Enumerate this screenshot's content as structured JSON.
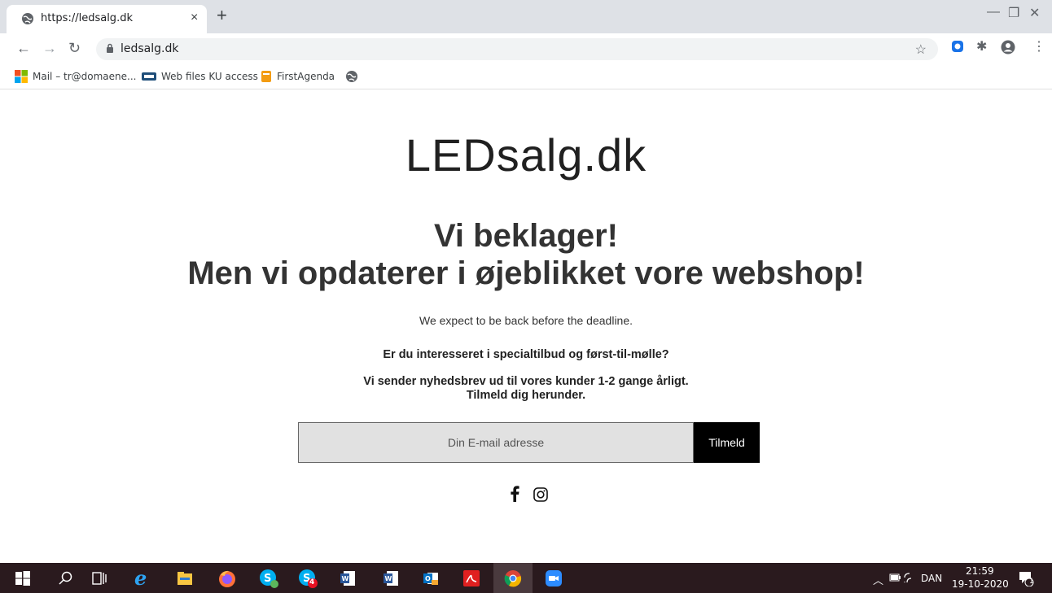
{
  "browser": {
    "tab_title": "https://ledsalg.dk",
    "tab_close": "×",
    "new_tab": "+",
    "url": "ledsalg.dk",
    "bookmarks": [
      {
        "label": "Mail – tr@domaene..."
      },
      {
        "label": "Web files KU access"
      },
      {
        "label": "FirstAgenda"
      }
    ]
  },
  "page": {
    "logo": "LEDsalg.dk",
    "headline_1": "Vi beklager!",
    "headline_2": "Men vi opdaterer i øjeblikket vore webshop!",
    "expect_text": "We expect to be back before the deadline.",
    "interest_text": "Er du interesseret i specialtilbud og først-til-mølle?",
    "newsletter_line1": "Vi sender nyhedsbrev ud til vores kunder 1-2 gange årligt.",
    "newsletter_line2": "Tilmeld dig herunder.",
    "email_placeholder": "Din E-mail adresse",
    "submit_label": "Tilmeld"
  },
  "taskbar": {
    "language": "DAN",
    "time": "21:59",
    "date": "19-10-2020",
    "skype_badge": "4",
    "notification_count": "1"
  },
  "colors": {
    "taskbar_bg": "#2a1a1e",
    "tabstrip_bg": "#dee1e6",
    "submit_bg": "#000000",
    "email_bg": "#e1e1e1"
  }
}
